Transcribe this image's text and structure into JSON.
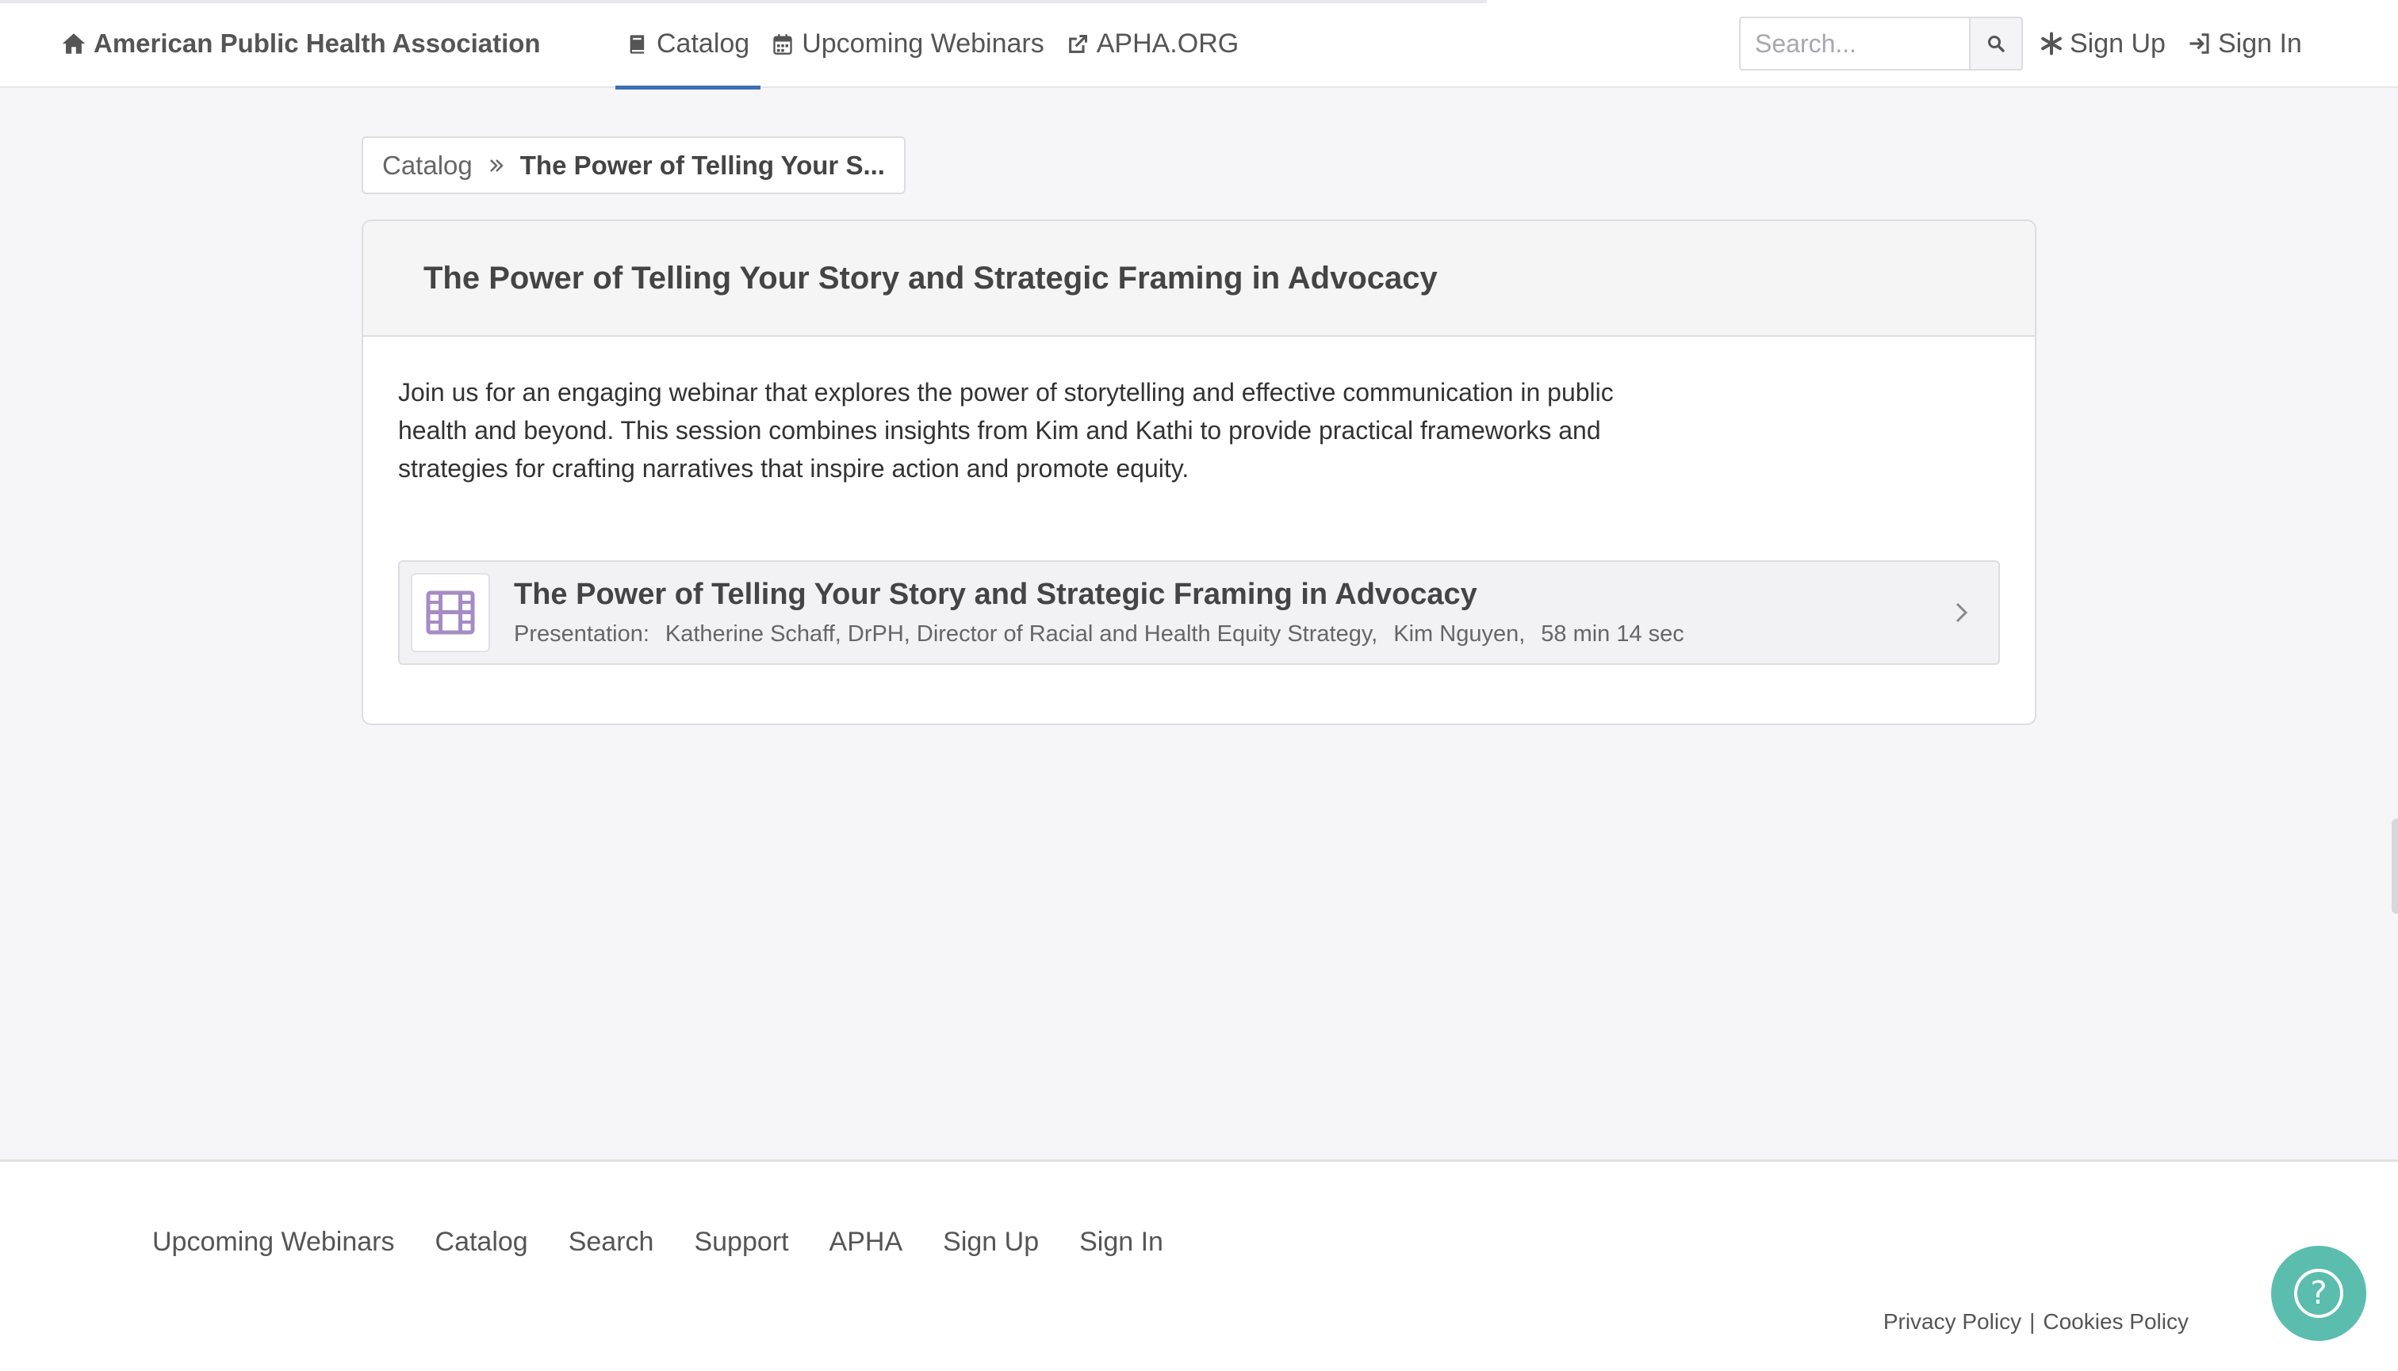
{
  "header": {
    "brand": "American Public Health Association",
    "nav": [
      {
        "label": "Catalog",
        "icon": "book-icon",
        "active": true
      },
      {
        "label": "Upcoming Webinars",
        "icon": "calendar-icon"
      },
      {
        "label": "APHA.ORG",
        "icon": "external-link-icon"
      }
    ],
    "search_placeholder": "Search...",
    "sign_up": "Sign Up",
    "sign_in": "Sign In"
  },
  "breadcrumb": {
    "root": "Catalog",
    "current": "The Power of Telling Your S..."
  },
  "course": {
    "title": "The Power of Telling Your Story and Strategic Framing in Advocacy",
    "description": "Join us for an engaging webinar that explores the power of storytelling and effective communication in public health and beyond. This session combines insights from Kim and Kathi to provide practical frameworks and strategies for crafting narratives that inspire action and promote equity.",
    "item": {
      "title": "The Power of Telling Your Story and Strategic Framing in Advocacy",
      "type": "Presentation:",
      "speaker1": "Katherine Schaff, DrPH, Director of Racial and Health Equity Strategy,",
      "speaker2": "Kim Nguyen,",
      "duration": "58 min 14 sec"
    }
  },
  "footer": {
    "links": [
      "Upcoming Webinars",
      "Catalog",
      "Search",
      "Support",
      "APHA",
      "Sign Up",
      "Sign In"
    ],
    "privacy": "Privacy Policy",
    "separator": "|",
    "cookies": "Cookies Policy"
  },
  "help_button": "?",
  "colors": {
    "accent": "#3b6fb7",
    "icon_purple": "#a58cc4",
    "help_teal": "#5bbdad",
    "page_bg": "#f6f6f9"
  }
}
